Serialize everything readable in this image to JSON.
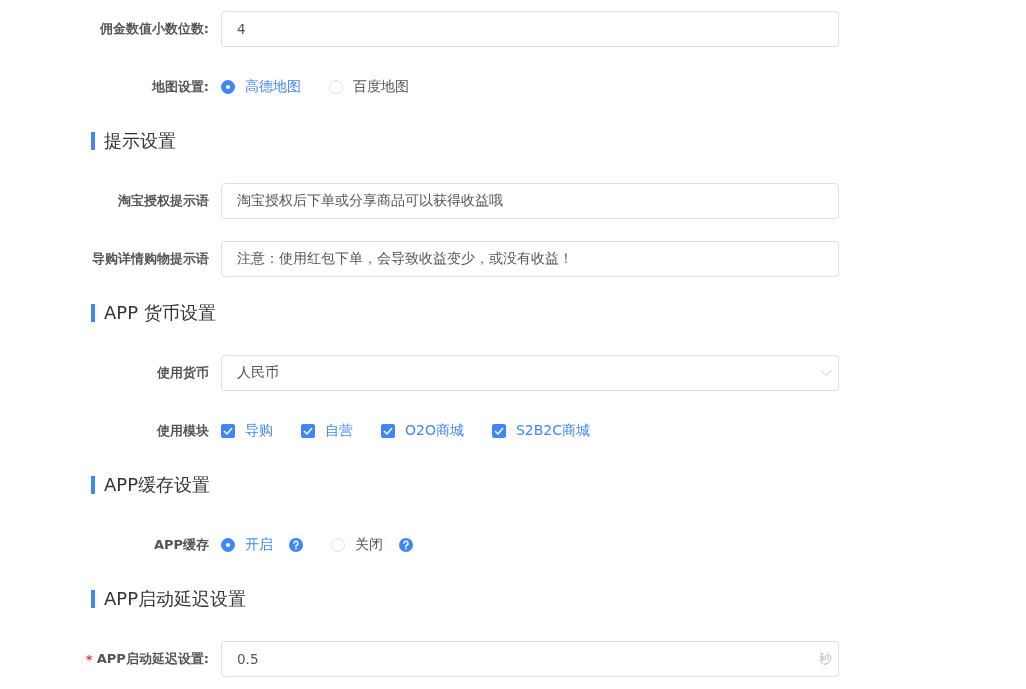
{
  "form": [
    {
      "kind": "input",
      "label": "佣金数值小数位数:",
      "value": "4"
    },
    {
      "kind": "radio",
      "label": "地图设置:",
      "options": [
        {
          "label": "高德地图",
          "selected": true,
          "help": false
        },
        {
          "label": "百度地图",
          "selected": false,
          "help": false
        }
      ]
    },
    {
      "kind": "heading",
      "title": "提示设置"
    },
    {
      "kind": "input",
      "label": "淘宝授权提示语",
      "value": "淘宝授权后下单或分享商品可以获得收益哦"
    },
    {
      "kind": "input",
      "label": "导购详情购物提示语",
      "value": "注意：使用红包下单，会导致收益变少，或没有收益！"
    },
    {
      "kind": "heading",
      "title": "APP 货币设置"
    },
    {
      "kind": "select",
      "label": "使用货币",
      "value": "人民币"
    },
    {
      "kind": "checkbox",
      "label": "使用模块",
      "options": [
        {
          "label": "导购",
          "checked": true
        },
        {
          "label": "自营",
          "checked": true
        },
        {
          "label": "O2O商城",
          "checked": true
        },
        {
          "label": "S2B2C商城",
          "checked": true
        }
      ]
    },
    {
      "kind": "heading",
      "title": "APP缓存设置"
    },
    {
      "kind": "radio",
      "label": "APP缓存",
      "options": [
        {
          "label": "开启",
          "selected": true,
          "help": true
        },
        {
          "label": "关闭",
          "selected": false,
          "help": true
        }
      ]
    },
    {
      "kind": "heading",
      "title": "APP启动延迟设置"
    },
    {
      "kind": "input",
      "label": "APP启动延迟设置:",
      "value": "0.5",
      "required_mark": "*",
      "suffix": "秒"
    }
  ]
}
